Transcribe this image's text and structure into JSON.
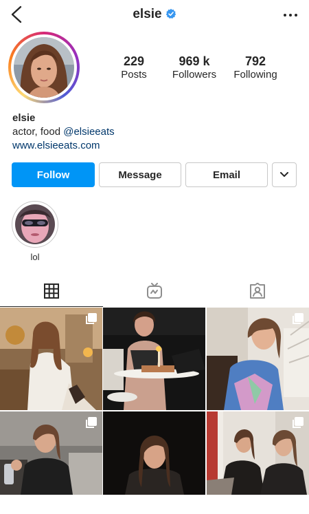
{
  "header": {
    "username": "elsie",
    "verified_icon": "verified-badge-icon"
  },
  "stats": [
    {
      "value": "229",
      "label": "Posts"
    },
    {
      "value": "969 k",
      "label": "Followers"
    },
    {
      "value": "792",
      "label": "Following"
    }
  ],
  "bio": {
    "name": "elsie",
    "text_prefix": "actor, food ",
    "mention": "@elsieeats",
    "website": "www.elsieeats.com"
  },
  "buttons": {
    "follow": "Follow",
    "message": "Message",
    "email": "Email"
  },
  "highlights": [
    {
      "label": "lol"
    }
  ],
  "tabs": [
    "grid-icon",
    "igtv-icon",
    "tagged-icon"
  ],
  "colors": {
    "follow_blue": "#0095f6",
    "link": "#00376b",
    "verified": "#3897f0"
  }
}
